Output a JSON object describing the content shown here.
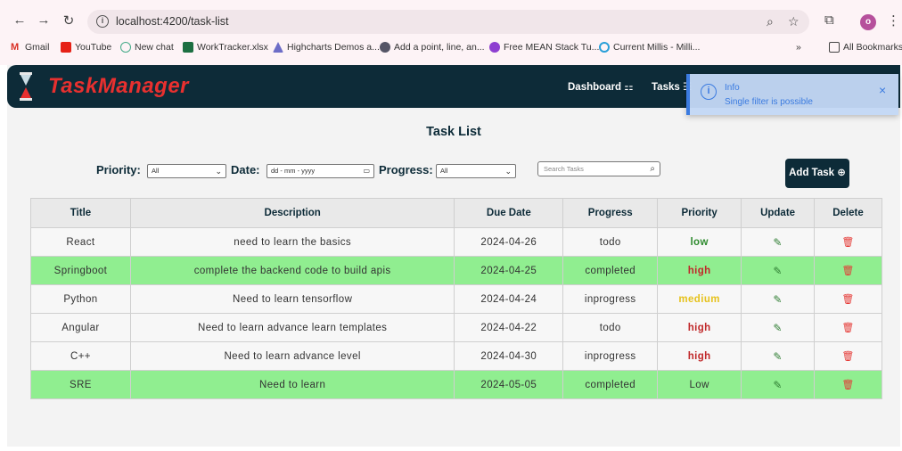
{
  "browser": {
    "url": "localhost:4200/task-list",
    "back_icon": "arrow-left-icon",
    "bookmarks": [
      "Gmail",
      "YouTube",
      "New chat",
      "WorkTracker.xlsx",
      "Highcharts Demos a...",
      "Add a point, line, an...",
      "Free MEAN Stack Tu...",
      "Current Millis - Milli..."
    ],
    "more": "»",
    "all_bookmarks": "All Bookmarks",
    "profile_initial": "o"
  },
  "app": {
    "brand": "TaskManager",
    "nav": {
      "dashboard": "Dashboard",
      "tasks": "Tasks"
    },
    "page_title": "Task List",
    "filters": {
      "priority_label": "Priority:",
      "priority_value": "All",
      "date_label": "Date:",
      "date_placeholder": "dd - mm - yyyy",
      "progress_label": "Progress:",
      "progress_value": "All",
      "search_placeholder": "Search Tasks"
    },
    "add_task_label": "Add Task",
    "toast": {
      "title": "Info",
      "message": "Single filter is possible"
    },
    "table": {
      "headers": [
        "Title",
        "Description",
        "Due Date",
        "Progress",
        "Priority",
        "Update",
        "Delete"
      ],
      "rows": [
        {
          "title": "React",
          "description": "need to learn the basics",
          "due": "2024-04-26",
          "progress": "todo",
          "priority": "low",
          "priority_color": "#2e8b2e"
        },
        {
          "title": "Springboot",
          "description": "complete the backend code to build apis",
          "due": "2024-04-25",
          "progress": "completed",
          "priority": "high",
          "priority_color": "#c0282a"
        },
        {
          "title": "Python",
          "description": "Need to learn tensorflow",
          "due": "2024-04-24",
          "progress": "inprogress",
          "priority": "medium",
          "priority_color": "#e6c21d"
        },
        {
          "title": "Angular",
          "description": "Need to learn advance learn templates",
          "due": "2024-04-22",
          "progress": "todo",
          "priority": "high",
          "priority_color": "#c0282a"
        },
        {
          "title": "C++",
          "description": "Need to learn advance level",
          "due": "2024-04-30",
          "progress": "inprogress",
          "priority": "high",
          "priority_color": "#c0282a"
        },
        {
          "title": "SRE",
          "description": "Need to learn",
          "due": "2024-05-05",
          "progress": "completed",
          "priority": "Low",
          "priority_color": "#333333"
        }
      ]
    }
  },
  "colors": {
    "brand_red": "#e8302f",
    "navy": "#0d2b38",
    "completed_row": "#90ee90",
    "info_blue": "#3b7be0"
  }
}
